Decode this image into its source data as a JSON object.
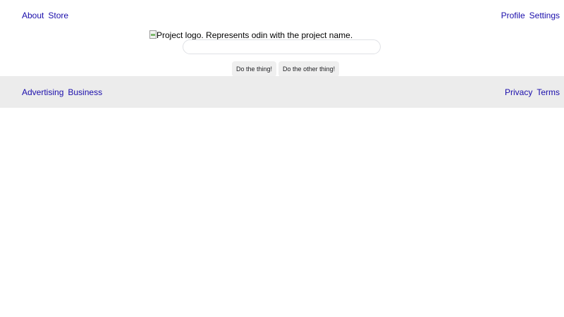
{
  "header": {
    "left_links": [
      "About",
      "Store"
    ],
    "right_links": [
      "Profile",
      "Settings"
    ]
  },
  "logo": {
    "alt_text": "Project logo. Represents odin with the project name."
  },
  "search": {
    "value": "",
    "placeholder": ""
  },
  "buttons": {
    "primary_label": "Do the thing!",
    "secondary_label": "Do the other thing!"
  },
  "footer": {
    "left_links": [
      "Advertising",
      "Business"
    ],
    "right_links": [
      "Privacy",
      "Terms"
    ]
  },
  "colors": {
    "link": "#1a0dab",
    "footer_bg": "#ececec",
    "button_bg": "#efefef",
    "input_border": "#dfe1e5"
  }
}
